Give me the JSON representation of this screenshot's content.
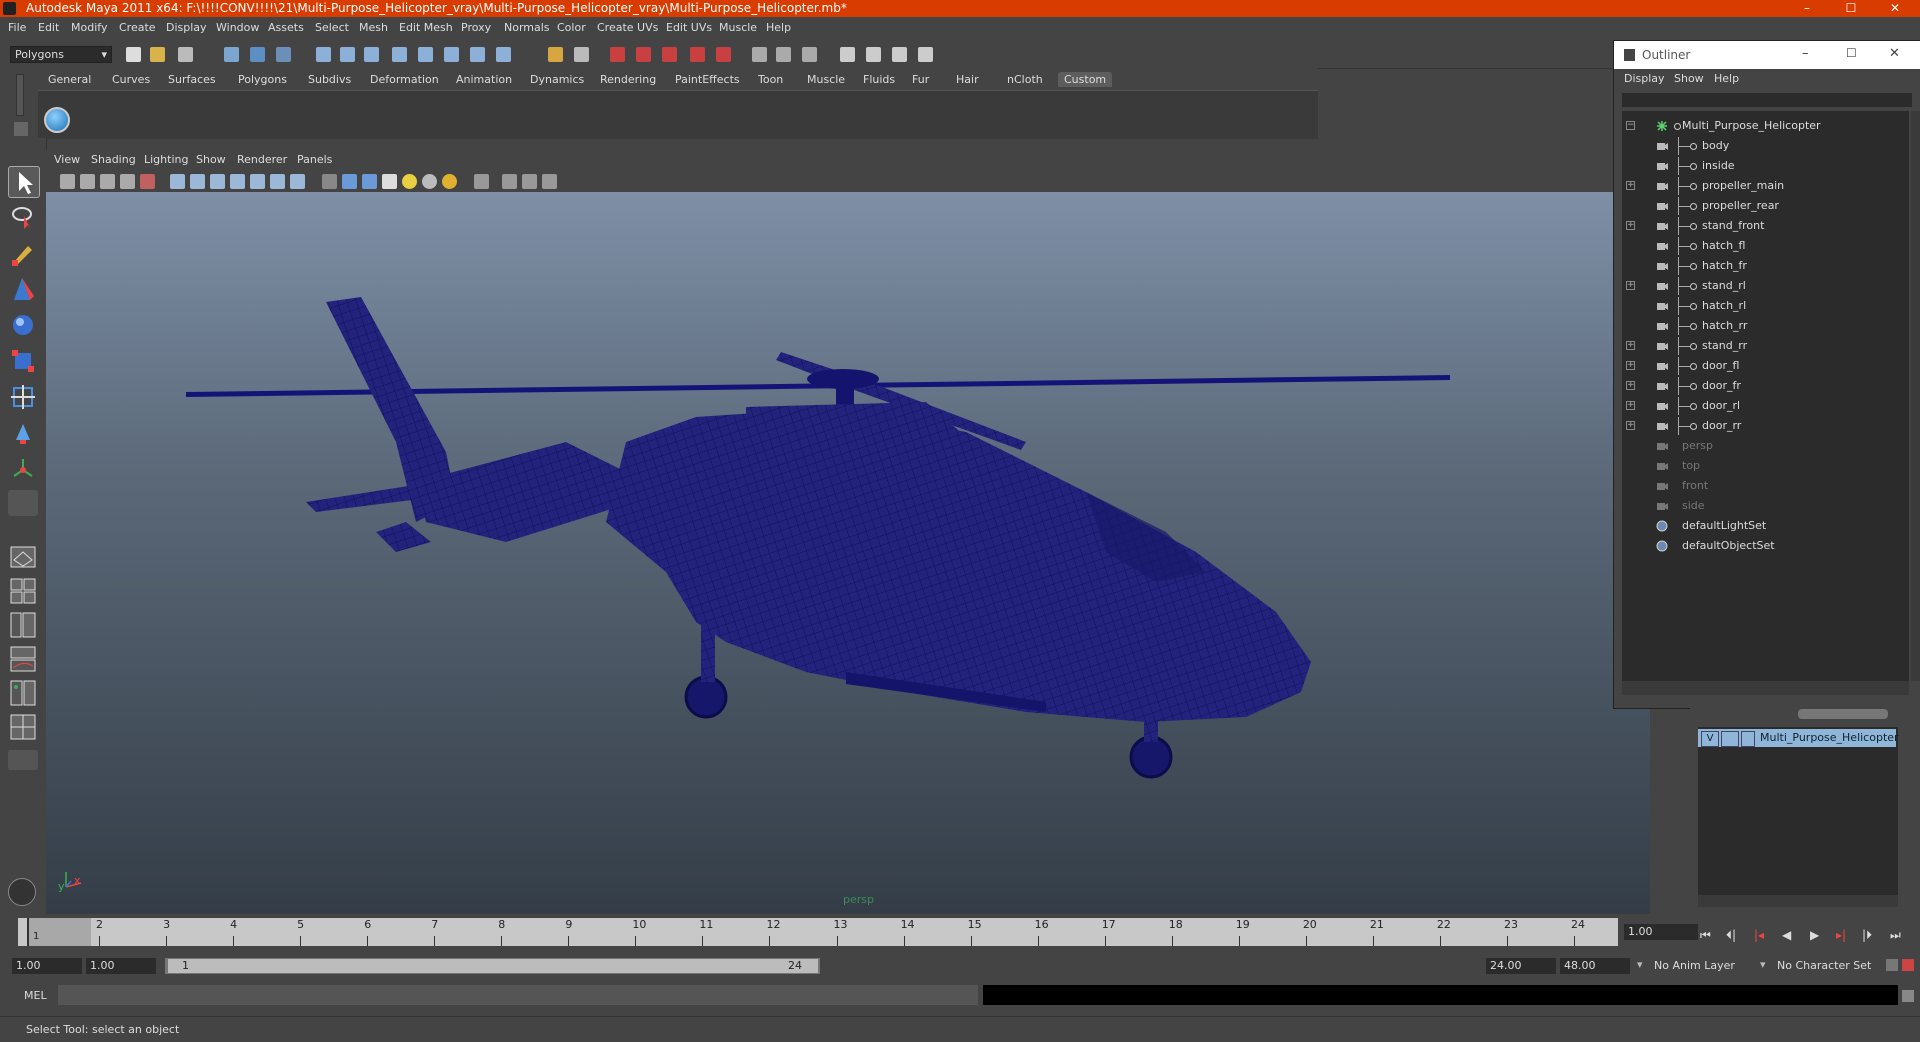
{
  "app": {
    "title": "Autodesk Maya 2011 x64: F:\\!!!!CONV!!!!\\21\\Multi-Purpose_Helicopter_vray\\Multi-Purpose_Helicopter_vray\\Multi-Purpose_Helicopter.mb*",
    "colors": {
      "titlebar": "#d83c00",
      "wireframe": "#13137a",
      "panel": "#444444"
    }
  },
  "window_controls": {
    "minimize": "–",
    "maximize": "☐",
    "close": "✕"
  },
  "menu": [
    "File",
    "Edit",
    "Modify",
    "Create",
    "Display",
    "Window",
    "Assets",
    "Select",
    "Mesh",
    "Edit Mesh",
    "Proxy",
    "Normals",
    "Color",
    "Create UVs",
    "Edit UVs",
    "Muscle",
    "Help"
  ],
  "toolbar": {
    "mode_combo": "Polygons"
  },
  "shelf": {
    "tabs": [
      "General",
      "Curves",
      "Surfaces",
      "Polygons",
      "Subdivs",
      "Deformation",
      "Animation",
      "Dynamics",
      "Rendering",
      "PaintEffects",
      "Toon",
      "Muscle",
      "Fluids",
      "Fur",
      "Hair",
      "nCloth",
      "Custom"
    ],
    "active_tab": "Custom"
  },
  "viewport": {
    "menu": [
      "View",
      "Shading",
      "Lighting",
      "Show",
      "Renderer",
      "Panels"
    ],
    "camera_label": "persp",
    "axis": {
      "x": "x",
      "y": "y"
    }
  },
  "outliner": {
    "title": "Outliner",
    "menu": [
      "Display",
      "Show",
      "Help"
    ],
    "items": [
      {
        "label": "Multi_Purpose_Helicopter",
        "depth": 0,
        "expander": "−",
        "icon": "group-icon",
        "dim": false
      },
      {
        "label": "body",
        "depth": 1,
        "expander": "",
        "icon": "mesh-icon",
        "dim": false
      },
      {
        "label": "inside",
        "depth": 1,
        "expander": "",
        "icon": "mesh-icon",
        "dim": false
      },
      {
        "label": "propeller_main",
        "depth": 1,
        "expander": "+",
        "icon": "mesh-icon",
        "dim": false
      },
      {
        "label": "propeller_rear",
        "depth": 1,
        "expander": "",
        "icon": "mesh-icon",
        "dim": false
      },
      {
        "label": "stand_front",
        "depth": 1,
        "expander": "+",
        "icon": "mesh-icon",
        "dim": false
      },
      {
        "label": "hatch_fl",
        "depth": 1,
        "expander": "",
        "icon": "mesh-icon",
        "dim": false
      },
      {
        "label": "hatch_fr",
        "depth": 1,
        "expander": "",
        "icon": "mesh-icon",
        "dim": false
      },
      {
        "label": "stand_rl",
        "depth": 1,
        "expander": "+",
        "icon": "mesh-icon",
        "dim": false
      },
      {
        "label": "hatch_rl",
        "depth": 1,
        "expander": "",
        "icon": "mesh-icon",
        "dim": false
      },
      {
        "label": "hatch_rr",
        "depth": 1,
        "expander": "",
        "icon": "mesh-icon",
        "dim": false
      },
      {
        "label": "stand_rr",
        "depth": 1,
        "expander": "+",
        "icon": "mesh-icon",
        "dim": false
      },
      {
        "label": "door_fl",
        "depth": 1,
        "expander": "+",
        "icon": "mesh-icon",
        "dim": false
      },
      {
        "label": "door_fr",
        "depth": 1,
        "expander": "+",
        "icon": "mesh-icon",
        "dim": false
      },
      {
        "label": "door_rl",
        "depth": 1,
        "expander": "+",
        "icon": "mesh-icon",
        "dim": false
      },
      {
        "label": "door_rr",
        "depth": 1,
        "expander": "+",
        "icon": "mesh-icon",
        "dim": false
      },
      {
        "label": "persp",
        "depth": 0,
        "expander": "",
        "icon": "camera-icon",
        "dim": true
      },
      {
        "label": "top",
        "depth": 0,
        "expander": "",
        "icon": "camera-icon",
        "dim": true
      },
      {
        "label": "front",
        "depth": 0,
        "expander": "",
        "icon": "camera-icon",
        "dim": true
      },
      {
        "label": "side",
        "depth": 0,
        "expander": "",
        "icon": "camera-icon",
        "dim": true
      },
      {
        "label": "defaultLightSet",
        "depth": 0,
        "expander": "",
        "icon": "set-icon",
        "dim": false
      },
      {
        "label": "defaultObjectSet",
        "depth": 0,
        "expander": "",
        "icon": "set-icon",
        "dim": false
      }
    ]
  },
  "layers": {
    "row": {
      "visible": "V",
      "name": "Multi_Purpose_Helicopter"
    }
  },
  "timeline": {
    "ticks": [
      "1",
      "2",
      "3",
      "4",
      "5",
      "6",
      "7",
      "8",
      "9",
      "10",
      "11",
      "12",
      "13",
      "14",
      "15",
      "16",
      "17",
      "18",
      "19",
      "20",
      "21",
      "22",
      "23",
      "24"
    ],
    "current_frame_marker": "1",
    "current_frame": "1.00"
  },
  "range": {
    "start": "1.00",
    "playback_start": "1.00",
    "slider_start": "1",
    "slider_end": "24",
    "playback_end": "24.00",
    "end": "48.00",
    "anim_layer": "No Anim Layer",
    "character_set": "No Character Set"
  },
  "command": {
    "lang": "MEL"
  },
  "status": {
    "message": "Select Tool: select an object"
  }
}
